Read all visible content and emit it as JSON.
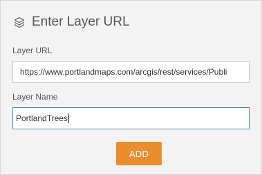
{
  "header": {
    "title": "Enter Layer URL",
    "icon": "layers-icon"
  },
  "fields": {
    "url_label": "Layer URL",
    "url_value": "https://www.portlandmaps.com/arcgis/rest/services/Publi",
    "name_label": "Layer Name",
    "name_value": "PortlandTrees"
  },
  "actions": {
    "add_label": "ADD"
  },
  "colors": {
    "panel_background": "#f3f3f3",
    "accent_button": "#e88e2e",
    "focused_border": "#5a7fa8"
  }
}
